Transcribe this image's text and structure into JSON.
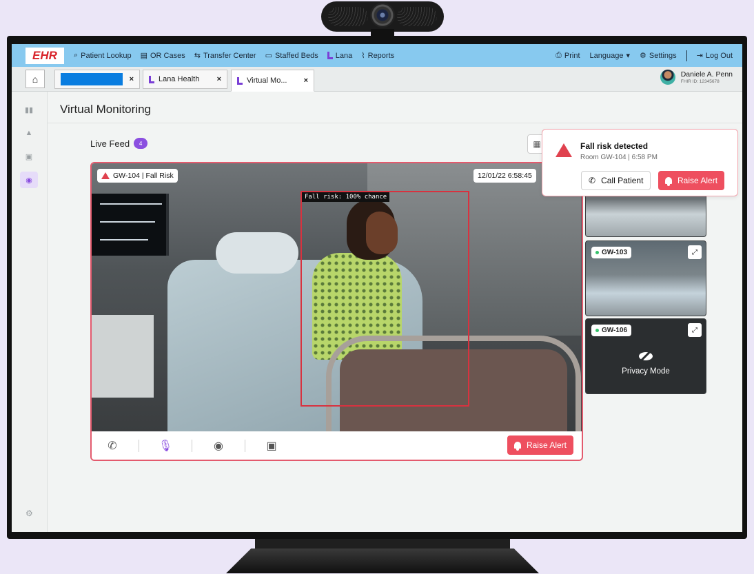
{
  "colors": {
    "accent": "#8b4fe0",
    "alert": "#ee4f5f",
    "nav": "#87c9ef",
    "brand": "#d8232a"
  },
  "nav": {
    "logo": "EHR",
    "items": [
      {
        "icon": "search-icon",
        "glyph": "⌕",
        "label": "Patient Lookup"
      },
      {
        "icon": "document-icon",
        "glyph": "▤",
        "label": "OR Cases"
      },
      {
        "icon": "handshake-icon",
        "glyph": "⇆",
        "label": "Transfer Center"
      },
      {
        "icon": "bed-icon",
        "glyph": "▭",
        "label": "Staffed Beds"
      },
      {
        "icon": "lana-icon",
        "glyph": "",
        "label": "Lana"
      },
      {
        "icon": "chart-icon",
        "glyph": "⌇",
        "label": "Reports"
      }
    ],
    "print": "Print",
    "language": "Language",
    "settings": "Settings",
    "logout": "Log Out"
  },
  "tabs": {
    "lana": "Lana Health",
    "virtual": "Virtual Mo...",
    "close": "×"
  },
  "user": {
    "name": "Daniele A. Penn",
    "fhir": "FHIR ID: 12345678"
  },
  "page": {
    "title": "Virtual Monitoring",
    "feed_label": "Live Feed",
    "feed_count": "4"
  },
  "main_feed": {
    "room_chip": "GW-104 | Fall Risk",
    "timestamp": "12/01/22 6:58:45",
    "detection": "Fall risk: 100% chance",
    "raise_alert": "Raise Alert"
  },
  "thumbs": [
    {
      "room": "GW-103"
    },
    {
      "room": "GW-106",
      "mode": "Privacy Mode"
    }
  ],
  "notification": {
    "title": "Fall risk detected",
    "subtitle": "Room GW-104  |  6:58 PM",
    "call": "Call Patient",
    "raise_alert": "Raise Alert"
  }
}
